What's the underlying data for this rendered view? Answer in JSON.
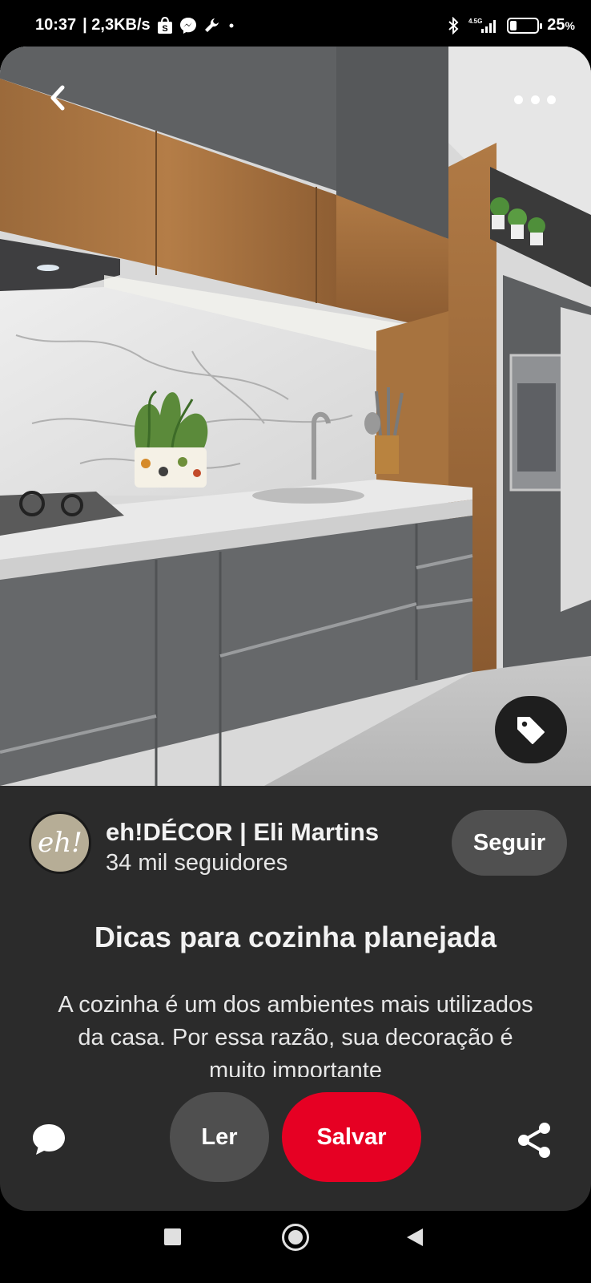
{
  "status_bar": {
    "time": "10:37",
    "network_speed": "| 2,3KB/s",
    "notification_icons": [
      "shopee-icon",
      "messenger-icon",
      "wrench-icon",
      "dot-icon"
    ],
    "network_type": "4.5G",
    "battery_percent": "25",
    "battery_unit": "%",
    "battery_level": 0.25
  },
  "pin": {
    "image_description_icons": [
      "back-arrow-icon",
      "more-options-icon",
      "shop-tag-icon"
    ],
    "creator": {
      "avatar_text": "eh!",
      "name": "eh!DÉCOR | Eli Martins",
      "followers": "34 mil seguidores",
      "follow_label": "Seguir"
    },
    "title": "Dicas para cozinha planejada",
    "description": "A cozinha é um dos ambientes mais utilizados da casa. Por essa razão, sua decoração é muito importante"
  },
  "actions": {
    "read_label": "Ler",
    "save_label": "Salvar",
    "colors": {
      "save": "#e60023",
      "read": "#4f4f4f",
      "card": "#2b2b2b"
    }
  }
}
